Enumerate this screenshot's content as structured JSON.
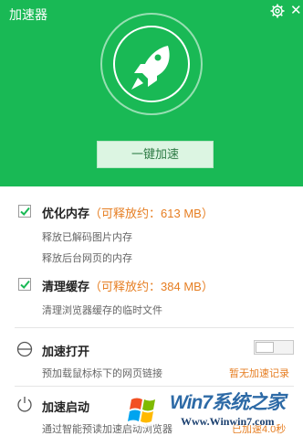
{
  "app": {
    "title": "加速器"
  },
  "icons": {
    "settings": "gear-icon",
    "close": "close-icon",
    "rocket": "rocket-icon"
  },
  "colors": {
    "brand_green": "#19b955",
    "accent_orange": "#e67e22"
  },
  "main": {
    "boost_button": "一键加速"
  },
  "memory": {
    "label": "优化内存",
    "releasable": "（可释放约：613 MB）",
    "checked": true,
    "details": [
      "释放已解码图片内存",
      "释放后台网页的内存"
    ]
  },
  "cache": {
    "label": "清理缓存",
    "releasable": "（可释放约：384 MB）",
    "checked": true,
    "details": [
      "清理浏览器缓存的临时文件"
    ]
  },
  "open_boost": {
    "label": "加速打开",
    "description": "预加载鼠标标下的网页链接",
    "link": "暂无加速记录",
    "enabled": false
  },
  "startup_boost": {
    "label": "加速启动",
    "description": "通过智能预读加速启动浏览器",
    "link": "已加速4.0秒"
  },
  "watermark": {
    "brand": "Win7系统之家",
    "url": "Www.Winwin7.com"
  }
}
